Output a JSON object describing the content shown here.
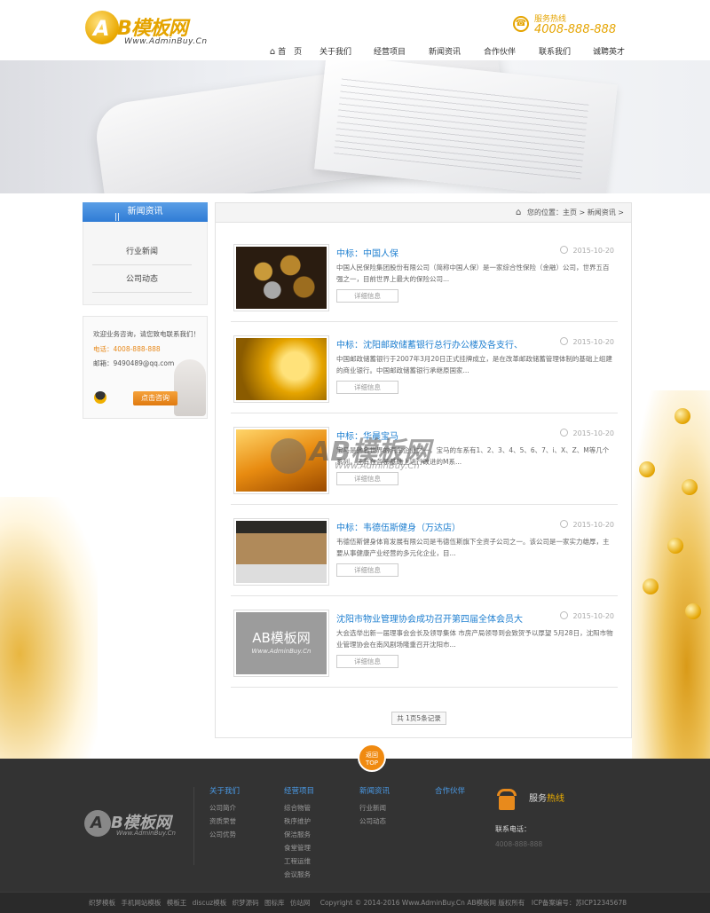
{
  "header": {
    "logo_letter": "A",
    "logo_text": "B模板网",
    "logo_sub": "Www.AdminBuy.Cn",
    "hotline_label": "服务热线",
    "hotline_number": "4008-888-888"
  },
  "nav": [
    {
      "label": "首　页"
    },
    {
      "label": "关于我们"
    },
    {
      "label": "经营项目"
    },
    {
      "label": "新闻资讯"
    },
    {
      "label": "合作伙伴"
    },
    {
      "label": "联系我们"
    },
    {
      "label": "诚聘英才"
    }
  ],
  "sidebar": {
    "title": "新闻资讯",
    "items": [
      {
        "label": "行业新闻"
      },
      {
        "label": "公司动态"
      }
    ],
    "contact": {
      "greeting": "欢迎业务咨询，请您致电联系我们！",
      "phone": "电话：4008-888-888",
      "email": "邮箱：9490489@qq.com",
      "consult_button": "点击咨询"
    }
  },
  "breadcrumb": {
    "prefix": "您的位置：",
    "home": "主页",
    "sep": ">",
    "current": "新闻资讯"
  },
  "news": [
    {
      "title": "中标：中国人保",
      "date": "2015-10-20",
      "desc": "中国人民保险集团股份有限公司（简称中国人保）是一家综合性保险（金融）公司，世界五百强之一，目前世界上最大的保险公司...",
      "button": "详细信息"
    },
    {
      "title": "中标：沈阳邮政储蓄银行总行办公楼及各支行、",
      "date": "2015-10-20",
      "desc": "中国邮政储蓄银行于2007年3月20日正式挂牌成立，是在改革邮政储蓄管理体制的基础上组建的商业银行。中国邮政储蓄银行承继原国家...",
      "button": "详细信息"
    },
    {
      "title": "中标：华晨宝马",
      "date": "2015-10-20",
      "desc": "宝马是驰名世界的汽车企业之一，宝马的车系有1、2、3、4、5、6、7、i、X、Z、M等几个系列，还有在各系基础上进行改进的M系...",
      "button": "详细信息"
    },
    {
      "title": "中标：韦德伍斯健身（万达店）",
      "date": "2015-10-20",
      "desc": "韦德伍斯健身体育发展有限公司是韦德伍斯旗下全资子公司之一。该公司是一家实力雄厚，主要从事健康产业经营的多元化企业，目...",
      "button": "详细信息"
    },
    {
      "title": "沈阳市物业管理协会成功召开第四届全体会员大",
      "date": "2015-10-20",
      "desc": "大会选举出新一届理事会会长及领导集体 市房产局领导到会致贺予以厚望 5月28日，沈阳市物业管理协会在南风剧场隆重召开沈阳市...",
      "button": "详细信息",
      "placeholder_title": "AB模板网",
      "placeholder_sub": "Www.AdminBuy.Cn"
    }
  ],
  "pager": "共 1页5条记录",
  "watermark": {
    "text": "AB模板网",
    "sub": "Www.AdminBuy.Cn"
  },
  "back_top": {
    "line1": "返回",
    "line2": "TOP"
  },
  "footer": {
    "logo_letter": "A",
    "logo_text": "B模板网",
    "logo_sub": "Www.AdminBuy.Cn",
    "columns": [
      {
        "title": "关于我们",
        "links": [
          "公司简介",
          "资质荣誉",
          "公司优势"
        ]
      },
      {
        "title": "经营项目",
        "links": [
          "综合物管",
          "秩序维护",
          "保洁服务",
          "食堂管理",
          "工程运维",
          "会议服务"
        ]
      },
      {
        "title": "新闻资讯",
        "links": [
          "行业新闻",
          "公司动态"
        ]
      },
      {
        "title": "合作伙伴",
        "links": []
      }
    ],
    "hotline_a": "服务",
    "hotline_b": "热线",
    "contact_label": "联系电话：",
    "contact_number": "4008-888-888"
  },
  "bottom": {
    "links": [
      "织梦模板",
      "手机网站模板",
      "模板王",
      "discuz模板",
      "织梦源码",
      "图标库",
      "仿站网"
    ],
    "copyright": "Copyright © 2014-2016 Www.AdminBuy.Cn AB模板网 版权所有　ICP备案编号：苏ICP12345678"
  },
  "colors": {
    "accent_blue": "#2f7cd5",
    "gold": "#e5a400",
    "orange": "#e88a1c",
    "footer_bg": "#333333"
  }
}
